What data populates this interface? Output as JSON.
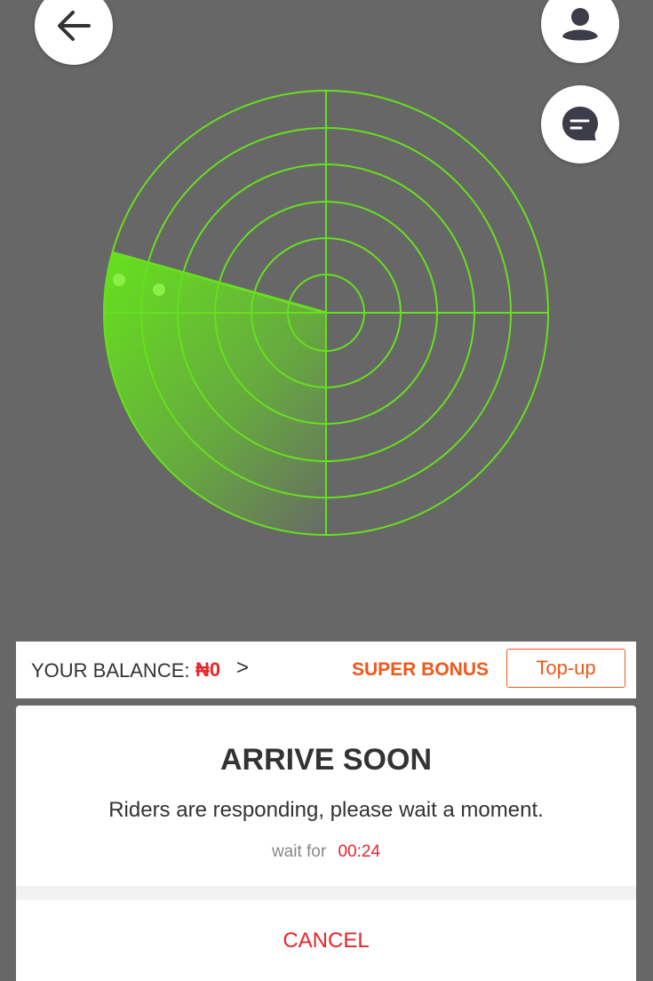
{
  "icons": {
    "back": "arrow-left-icon",
    "profile": "user-icon",
    "chat": "chat-icon"
  },
  "balance": {
    "label": "YOUR BALANCE:",
    "amount": "₦0",
    "chevron": ">",
    "super_bonus": "SUPER BONUS",
    "topup": "Top-up"
  },
  "status": {
    "title": "ARRIVE SOON",
    "message": "Riders are responding, please wait a moment.",
    "wait_label": "wait for",
    "wait_time": "00:24"
  },
  "actions": {
    "cancel": "CANCEL"
  },
  "colors": {
    "background": "#676767",
    "radar": "#66e01e",
    "accent_red": "#e5262b",
    "accent_orange": "#f0571b"
  }
}
